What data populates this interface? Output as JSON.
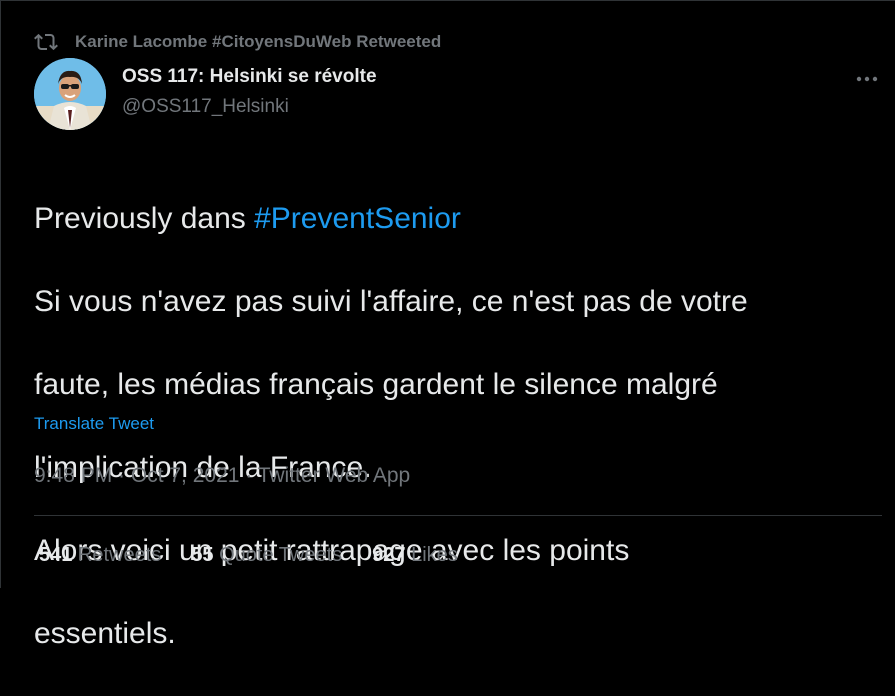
{
  "colors": {
    "background": "#000000",
    "primary_text": "#e7e9ea",
    "secondary_text": "#71767b",
    "link": "#1d9bf0",
    "border": "#2f3336"
  },
  "retweet_context": {
    "icon": "retweet-icon",
    "text": "Karine Lacombe #CitoyensDuWeb Retweeted"
  },
  "author": {
    "display_name": "OSS 117: Helsinki se révolte",
    "handle": "@OSS117_Helsinki",
    "avatar": "avatar-image"
  },
  "more_icon": "more-icon",
  "tweet": {
    "line1_prefix": "Previously dans ",
    "line1_hashtag": "#PreventSenior",
    "line2": "Si vous n'avez pas suivi l'affaire, ce n'est pas de votre",
    "line3": "faute, les médias français gardent le silence malgré",
    "line4": "l'implication de la France.",
    "line5": "Alors voici un petit rattrapage avec les points",
    "line6": "essentiels."
  },
  "translate_label": "Translate Tweet",
  "meta": {
    "text": "9:48 PM · Oct 7, 2021 · Twitter Web App"
  },
  "stats": {
    "retweets_count": "541",
    "retweets_label": "Retweets",
    "quotes_count": "55",
    "quotes_label": "Quote Tweets",
    "likes_count": "927",
    "likes_label": "Likes"
  }
}
